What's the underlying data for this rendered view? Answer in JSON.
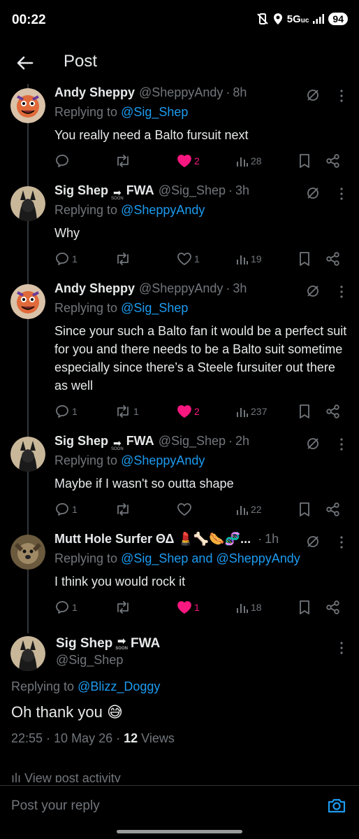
{
  "status_bar": {
    "time": "00:22",
    "network": "5G",
    "network_sub": "uc",
    "battery": "94"
  },
  "header": {
    "title": "Post"
  },
  "replies": [
    {
      "name": "Andy Sheppy",
      "handle": "@SheppyAndy",
      "time": "8h",
      "replying_prefix": "Replying to",
      "replying_to": "@Sig_Shep",
      "text": "You really need a Balto fursuit next",
      "reply_count": "",
      "repost_count": "",
      "like_count": "2",
      "liked": true,
      "view_count": "28"
    },
    {
      "name": "Sig Shep",
      "name_suffix": "FWA",
      "badge": "SOON",
      "handle": "@Sig_Shep",
      "time": "3h",
      "replying_prefix": "Replying to",
      "replying_to": "@SheppyAndy",
      "text": "Why",
      "reply_count": "1",
      "repost_count": "",
      "like_count": "1",
      "liked": false,
      "view_count": "19"
    },
    {
      "name": "Andy Sheppy",
      "handle": "@SheppyAndy",
      "time": "3h",
      "replying_prefix": "Replying to",
      "replying_to": "@Sig_Shep",
      "text": "Since your such a Balto fan it would be a perfect suit for you and there needs to be a Balto suit sometime especially since there’s a Steele fursuiter out there as well",
      "reply_count": "1",
      "repost_count": "1",
      "like_count": "2",
      "liked": true,
      "view_count": "237"
    },
    {
      "name": "Sig Shep",
      "name_suffix": "FWA",
      "badge": "SOON",
      "handle": "@Sig_Shep",
      "time": "2h",
      "replying_prefix": "Replying to",
      "replying_to": "@SheppyAndy",
      "text": "Maybe if I wasn't so outta shape",
      "reply_count": "1",
      "repost_count": "",
      "like_count": "",
      "liked": false,
      "view_count": "22"
    },
    {
      "name": "Mutt Hole Surfer ΘΔ 💄🦴🌭🧬...",
      "handle": "",
      "time": "1h",
      "replying_prefix": "Replying to",
      "replying_to": "@Sig_Shep and @SheppyAndy",
      "text": "I think you would rock it",
      "reply_count": "1",
      "repost_count": "",
      "like_count": "1",
      "liked": true,
      "view_count": "18"
    }
  ],
  "main_post": {
    "name": "Sig Shep",
    "name_suffix": "FWA",
    "badge": "SOON",
    "handle": "@Sig_Shep",
    "replying_prefix": "Replying to",
    "replying_to": "@Blizz_Doggy",
    "text": "Oh thank you 😅",
    "timestamp": "22:55 · 10 May 26 · ",
    "views_count": "12",
    "views_label": "Views",
    "activity_label": "View post activity"
  },
  "reply_bar": {
    "placeholder": "Post your reply"
  },
  "colors": {
    "accent": "#1d9bf0",
    "like": "#f91880",
    "muted": "#71767b",
    "text": "#e7e9ea",
    "background": "#000000"
  }
}
